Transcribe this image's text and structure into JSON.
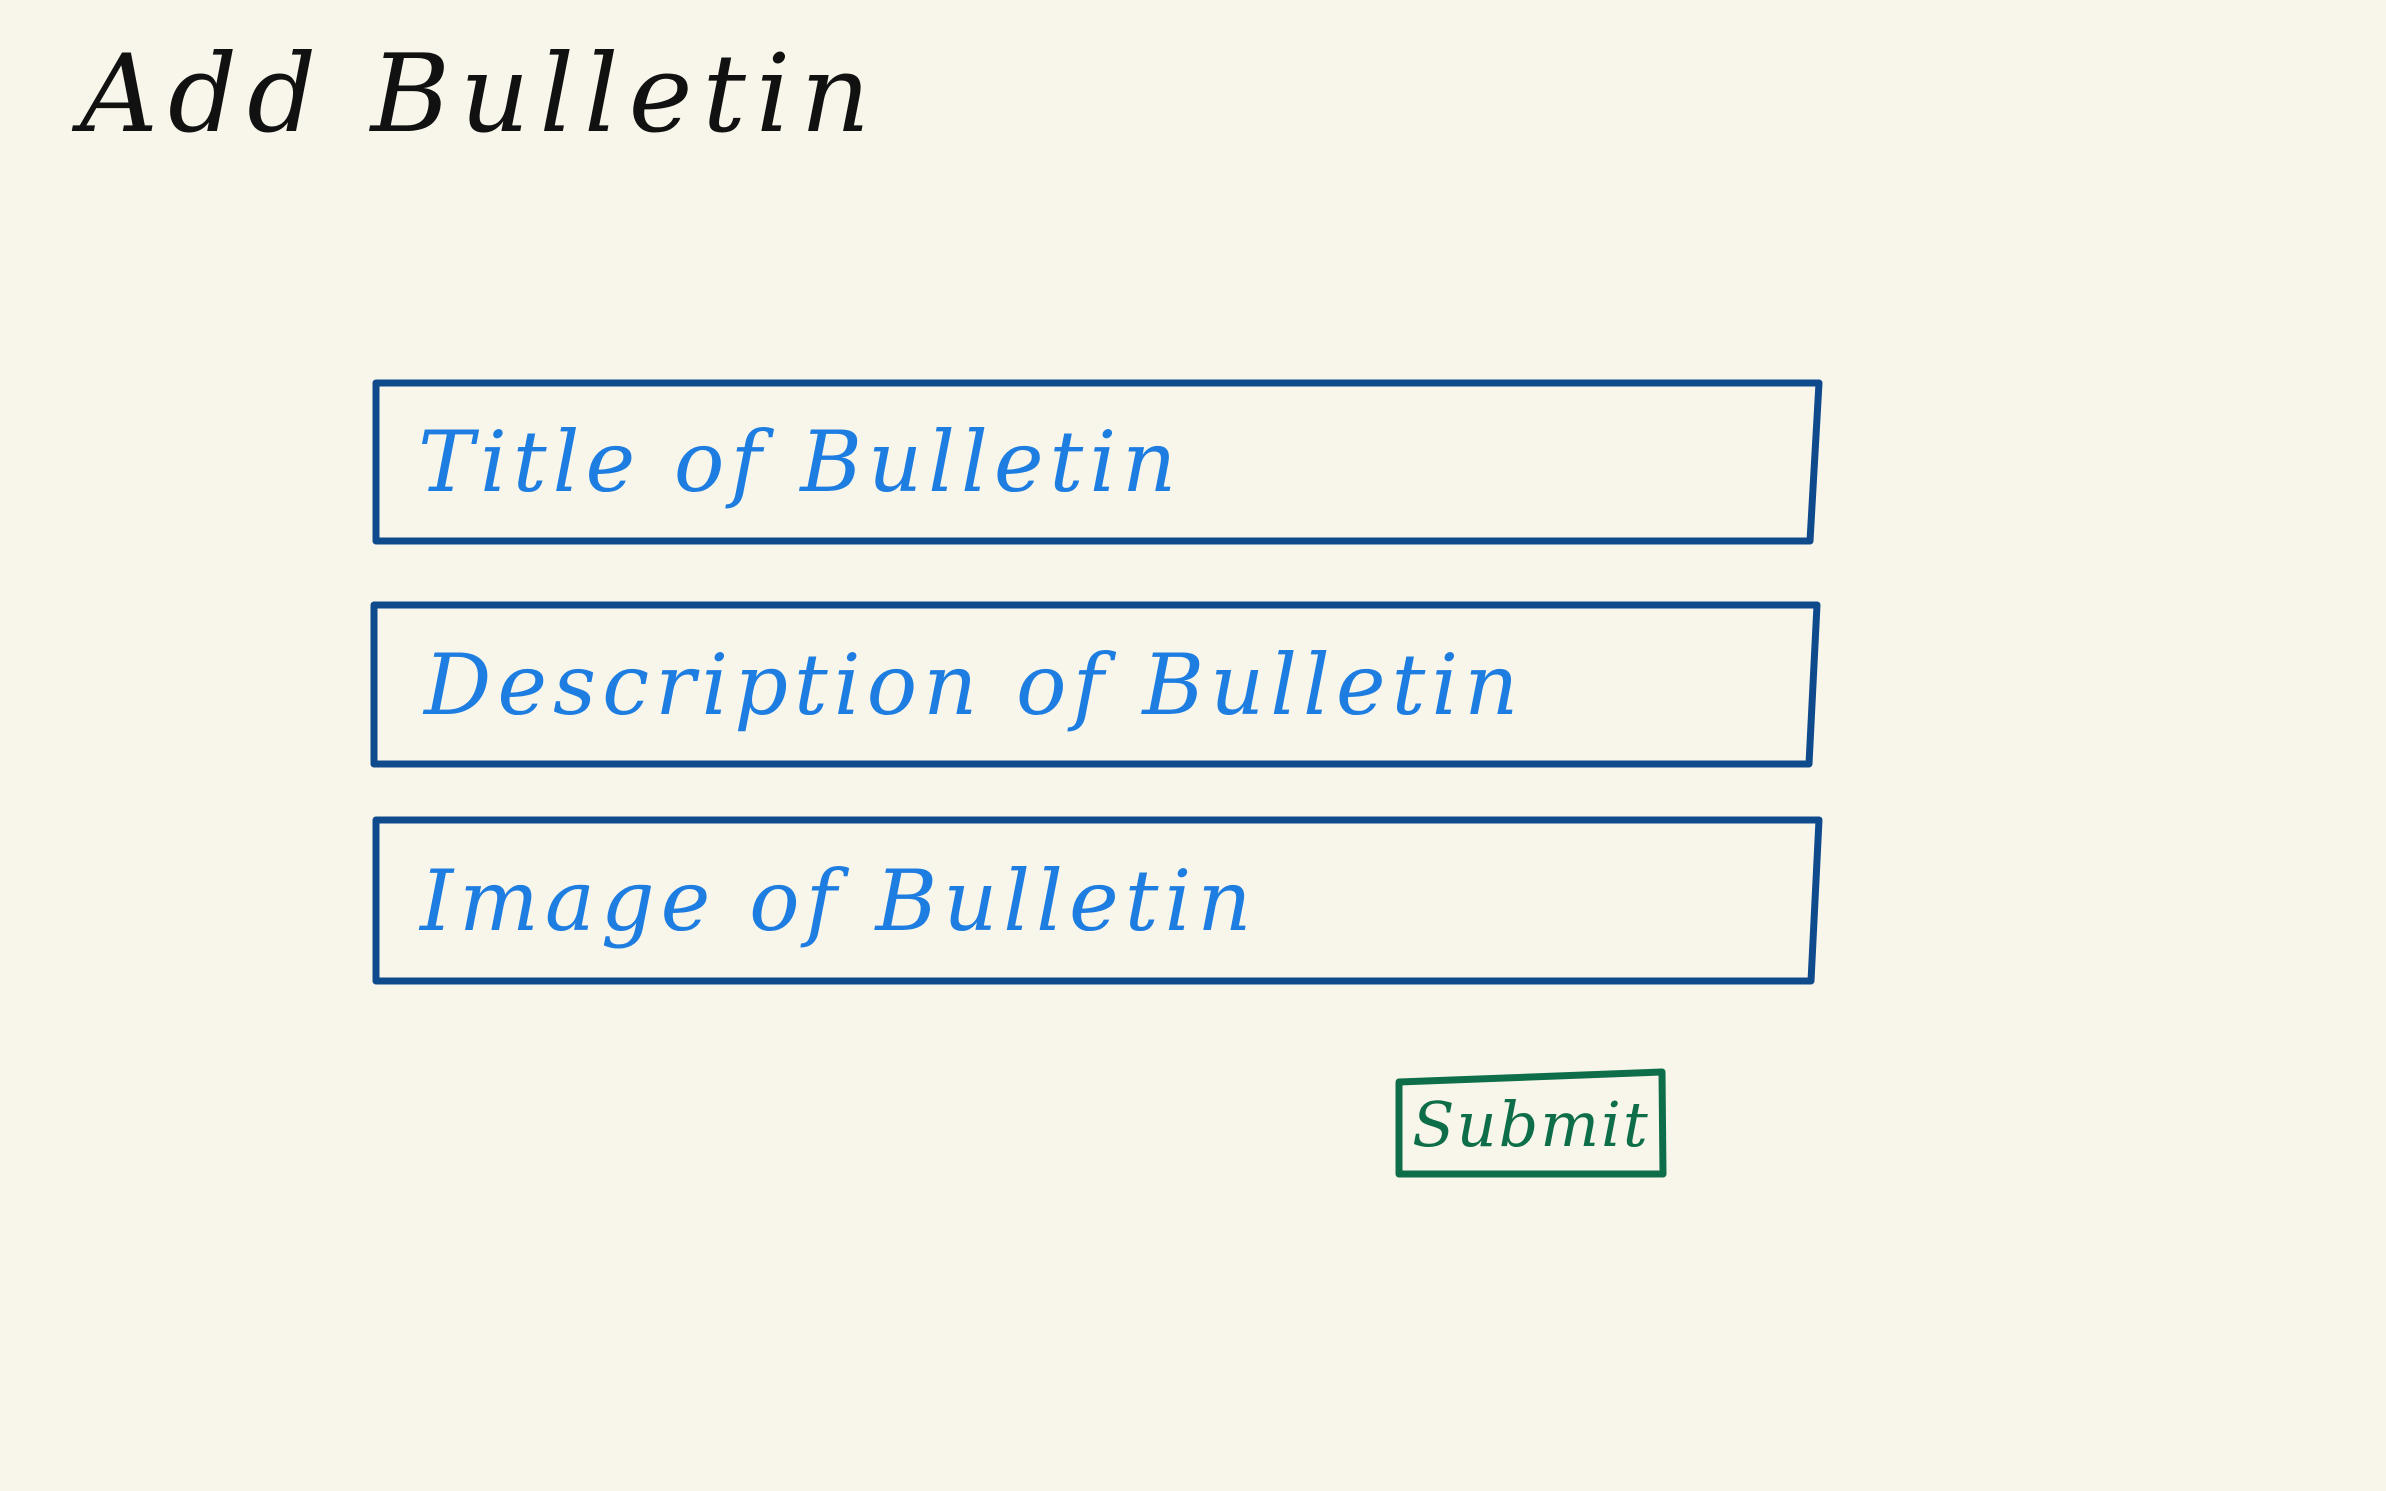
{
  "page": {
    "title": "Add Bulletin"
  },
  "form": {
    "fields": [
      {
        "placeholder": "Title of Bulletin"
      },
      {
        "placeholder": "Description of Bulletin"
      },
      {
        "placeholder": "Image of Bulletin"
      }
    ],
    "submit_label": "Submit"
  },
  "colors": {
    "background": "#f8f6ea",
    "title": "#111111",
    "field_border": "#0f4a8c",
    "field_text": "#1e7de0",
    "submit": "#0f6e4a"
  }
}
